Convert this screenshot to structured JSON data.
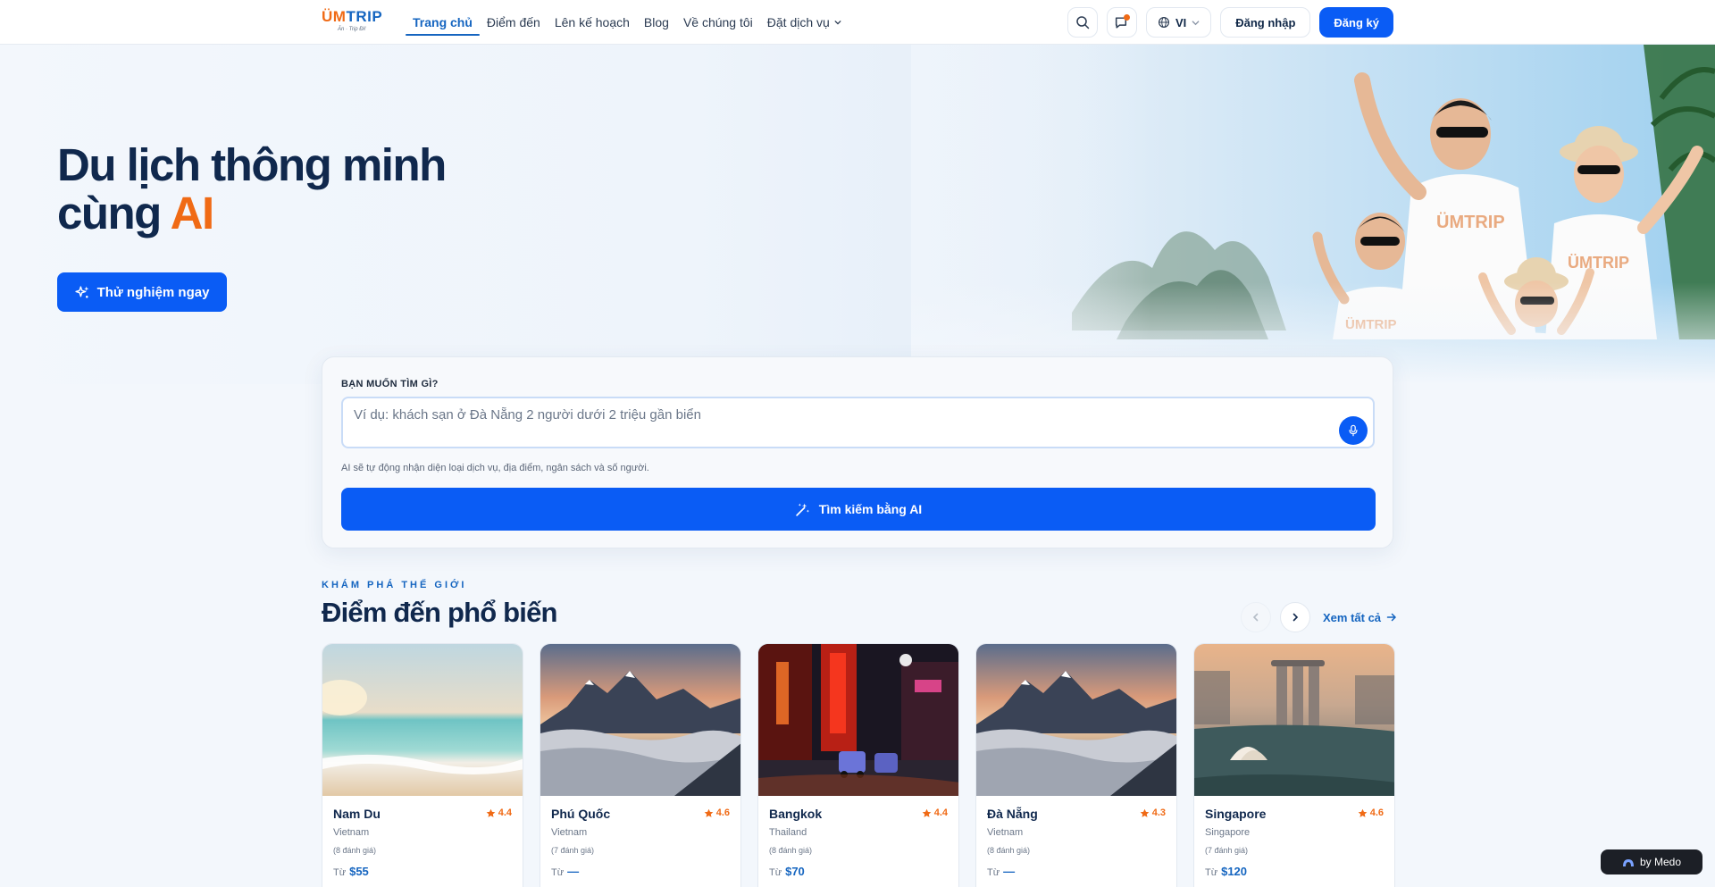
{
  "brand": {
    "name_u": "ÜM",
    "name_rest": "TRIP",
    "tagline": "Ăn · Trip Đi!"
  },
  "nav": {
    "links": [
      "Trang chủ",
      "Điểm đến",
      "Lên kế hoạch",
      "Blog",
      "Về chúng tôi",
      "Đặt dịch vụ"
    ],
    "active_index": 0,
    "language": "VI",
    "login_label": "Đăng nhập",
    "signup_label": "Đăng ký"
  },
  "hero": {
    "title_line1": "Du lịch thông minh",
    "title_line2_prefix": "cùng ",
    "title_line2_highlight": "AI",
    "cta_label": "Thử nghiệm ngay",
    "shirt_brand": "ÜMTRIP"
  },
  "search": {
    "label": "BẠN MUỐN TÌM GÌ?",
    "placeholder": "Ví dụ: khách sạn ở Đà Nẵng 2 người dưới 2 triệu gần biển",
    "hint": "AI sẽ tự động nhận diện loại dịch vụ, địa điểm, ngân sách và số người.",
    "button_label": "Tìm kiếm bằng AI"
  },
  "destinations": {
    "eyebrow": "KHÁM PHÁ THẾ GIỚI",
    "title": "Điểm đến phổ biến",
    "view_all": "Xem tất cả",
    "price_prefix": "Từ",
    "cards": [
      {
        "name": "Nam Du",
        "rating": "4.4",
        "country": "Vietnam",
        "reviews": "(8 đánh giá)",
        "price": "$55",
        "image": "beach"
      },
      {
        "name": "Phú Quốc",
        "rating": "4.6",
        "country": "Vietnam",
        "reviews": "(7 đánh giá)",
        "price": "—",
        "image": "mountain"
      },
      {
        "name": "Bangkok",
        "rating": "4.4",
        "country": "Thailand",
        "reviews": "(8 đánh giá)",
        "price": "$70",
        "image": "city-night"
      },
      {
        "name": "Đà Nẵng",
        "rating": "4.3",
        "country": "Vietnam",
        "reviews": "(8 đánh giá)",
        "price": "—",
        "image": "mountain"
      },
      {
        "name": "Singapore",
        "rating": "4.6",
        "country": "Singapore",
        "reviews": "(7 đánh giá)",
        "price": "$120",
        "image": "skyline"
      }
    ]
  },
  "badge": {
    "label": "by Medo"
  },
  "colors": {
    "primary": "#0a5cf5",
    "accent": "#f06a15",
    "heading": "#10284d",
    "link": "#1565c0"
  }
}
